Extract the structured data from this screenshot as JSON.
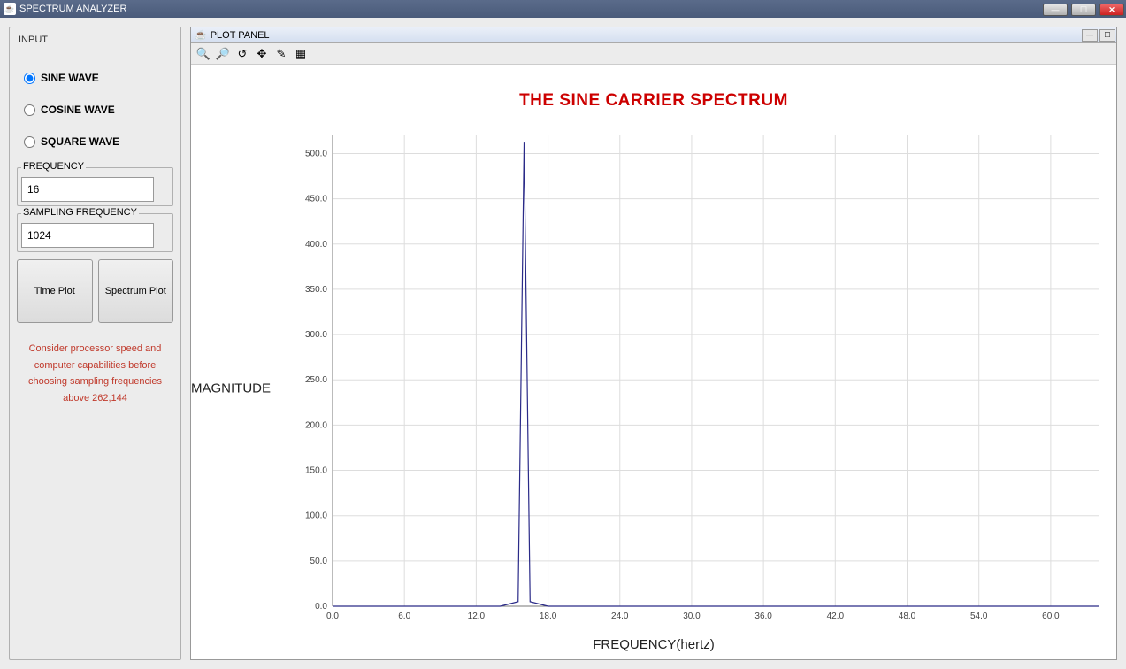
{
  "window": {
    "title": "SPECTRUM ANALYZER"
  },
  "input": {
    "group_label": "INPUT",
    "wave_options": [
      {
        "label": "SINE WAVE",
        "selected": true
      },
      {
        "label": "COSINE WAVE",
        "selected": false
      },
      {
        "label": "SQUARE WAVE",
        "selected": false
      }
    ],
    "frequency_label": "FREQUENCY",
    "frequency_value": "16",
    "sampling_label": "SAMPLING FREQUENCY",
    "sampling_value": "1024",
    "time_plot_label": "Time Plot",
    "spectrum_plot_label": "Spectrum Plot",
    "warning": "Consider processor speed and computer capabilities before choosing sampling frequencies above 262,144"
  },
  "plot_panel": {
    "title": "PLOT PANEL",
    "toolbar_icons": [
      "zoom-in-icon",
      "zoom-box-icon",
      "zoom-reset-icon",
      "pan-arrows-icon",
      "edit-icon",
      "grid-icon"
    ]
  },
  "chart_data": {
    "type": "line",
    "title": "THE SINE CARRIER SPECTRUM",
    "xlabel": "FREQUENCY(hertz)",
    "ylabel": "MAGNITUDE",
    "xlim": [
      0,
      64
    ],
    "ylim": [
      0,
      520
    ],
    "x_ticks": [
      0,
      6,
      12,
      18,
      24,
      30,
      36,
      42,
      48,
      54,
      60
    ],
    "y_ticks": [
      0,
      50,
      100,
      150,
      200,
      250,
      300,
      350,
      400,
      450,
      500
    ],
    "x": [
      0,
      14,
      15.5,
      16,
      16.5,
      18,
      64
    ],
    "y": [
      0,
      0,
      5,
      512,
      5,
      0,
      0
    ]
  }
}
